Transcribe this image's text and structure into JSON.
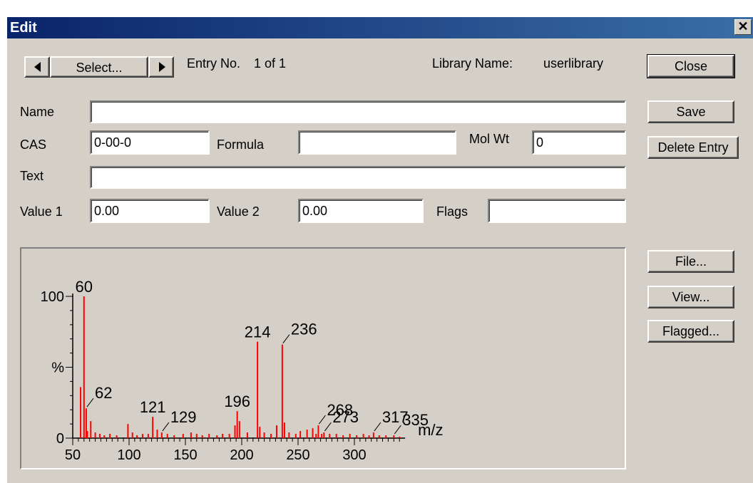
{
  "window": {
    "title": "Edit"
  },
  "nav": {
    "select_label": "Select...",
    "entry_label": "Entry No.",
    "entry_value": "1 of 1",
    "library_label": "Library Name:",
    "library_value": "userlibrary"
  },
  "buttons": {
    "close": "Close",
    "save": "Save",
    "delete": "Delete Entry",
    "file": "File...",
    "view": "View...",
    "flagged": "Flagged..."
  },
  "fields": {
    "name": {
      "label": "Name",
      "value": ""
    },
    "cas": {
      "label": "CAS",
      "value": "0-00-0"
    },
    "formula": {
      "label": "Formula",
      "value": ""
    },
    "molwt": {
      "label": "Mol Wt",
      "value": "0"
    },
    "text": {
      "label": "Text",
      "value": ""
    },
    "value1": {
      "label": "Value 1",
      "value": "0.00"
    },
    "value2": {
      "label": "Value 2",
      "value": "0.00"
    },
    "flags": {
      "label": "Flags",
      "value": ""
    }
  },
  "chart_data": {
    "type": "bar",
    "color": "#ff0000",
    "xlabel": "m/z",
    "xlim": [
      50,
      345
    ],
    "ylim": [
      0,
      100
    ],
    "y_ticks": [
      "0",
      "%",
      "100"
    ],
    "x_ticks": [
      50,
      100,
      150,
      200,
      250,
      300
    ],
    "peaks": [
      {
        "mz": 57,
        "i": 36
      },
      {
        "mz": 60,
        "i": 100
      },
      {
        "mz": 62,
        "i": 21
      },
      {
        "mz": 63,
        "i": 5
      },
      {
        "mz": 66,
        "i": 12
      },
      {
        "mz": 70,
        "i": 4
      },
      {
        "mz": 74,
        "i": 3
      },
      {
        "mz": 78,
        "i": 2
      },
      {
        "mz": 83,
        "i": 3
      },
      {
        "mz": 89,
        "i": 2
      },
      {
        "mz": 99,
        "i": 10
      },
      {
        "mz": 103,
        "i": 4
      },
      {
        "mz": 107,
        "i": 2
      },
      {
        "mz": 112,
        "i": 3
      },
      {
        "mz": 117,
        "i": 3
      },
      {
        "mz": 121,
        "i": 15
      },
      {
        "mz": 125,
        "i": 6
      },
      {
        "mz": 129,
        "i": 4
      },
      {
        "mz": 134,
        "i": 3
      },
      {
        "mz": 140,
        "i": 2
      },
      {
        "mz": 148,
        "i": 3
      },
      {
        "mz": 155,
        "i": 4
      },
      {
        "mz": 160,
        "i": 3
      },
      {
        "mz": 165,
        "i": 2
      },
      {
        "mz": 171,
        "i": 3
      },
      {
        "mz": 178,
        "i": 2
      },
      {
        "mz": 183,
        "i": 3
      },
      {
        "mz": 189,
        "i": 3
      },
      {
        "mz": 194,
        "i": 9
      },
      {
        "mz": 196,
        "i": 19
      },
      {
        "mz": 198,
        "i": 12
      },
      {
        "mz": 205,
        "i": 4
      },
      {
        "mz": 214,
        "i": 68
      },
      {
        "mz": 216,
        "i": 8
      },
      {
        "mz": 220,
        "i": 4
      },
      {
        "mz": 226,
        "i": 3
      },
      {
        "mz": 231,
        "i": 9
      },
      {
        "mz": 236,
        "i": 66
      },
      {
        "mz": 238,
        "i": 11
      },
      {
        "mz": 242,
        "i": 4
      },
      {
        "mz": 248,
        "i": 3
      },
      {
        "mz": 252,
        "i": 5
      },
      {
        "mz": 258,
        "i": 6
      },
      {
        "mz": 263,
        "i": 7
      },
      {
        "mz": 266,
        "i": 3
      },
      {
        "mz": 268,
        "i": 9
      },
      {
        "mz": 271,
        "i": 3
      },
      {
        "mz": 273,
        "i": 4
      },
      {
        "mz": 278,
        "i": 3
      },
      {
        "mz": 284,
        "i": 3
      },
      {
        "mz": 290,
        "i": 2
      },
      {
        "mz": 296,
        "i": 3
      },
      {
        "mz": 302,
        "i": 2
      },
      {
        "mz": 308,
        "i": 3
      },
      {
        "mz": 313,
        "i": 2
      },
      {
        "mz": 317,
        "i": 4
      },
      {
        "mz": 322,
        "i": 2
      },
      {
        "mz": 328,
        "i": 2
      },
      {
        "mz": 335,
        "i": 2
      },
      {
        "mz": 340,
        "i": 1
      }
    ],
    "peak_labels": [
      {
        "mz": 60,
        "text": "60"
      },
      {
        "mz": 62,
        "text": "62"
      },
      {
        "mz": 121,
        "text": "121"
      },
      {
        "mz": 129,
        "text": "129"
      },
      {
        "mz": 196,
        "text": "196"
      },
      {
        "mz": 214,
        "text": "214"
      },
      {
        "mz": 236,
        "text": "236"
      },
      {
        "mz": 268,
        "text": "268"
      },
      {
        "mz": 273,
        "text": "273"
      },
      {
        "mz": 317,
        "text": "317"
      },
      {
        "mz": 335,
        "text": "335"
      }
    ]
  }
}
